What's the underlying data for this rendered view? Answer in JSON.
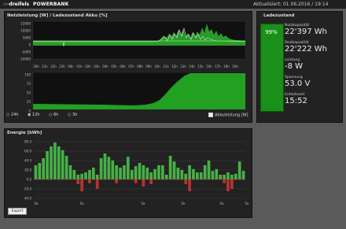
{
  "header": {
    "logo": "dreifels",
    "brand": "POWERBANK",
    "updated": "Aktualisiert: 01.06.2016 / 19:14"
  },
  "top_panel": {
    "title": "Netzleistung [W] / Ladezustand Akku [%]",
    "power_ticks": [
      "15000",
      "10000",
      "5000",
      "0",
      "-5000",
      "-10000"
    ],
    "time_ticks": [
      "20h",
      "21h",
      "22h",
      "23h",
      "00h",
      "01h",
      "02h",
      "03h",
      "04h",
      "05h",
      "06h",
      "07h",
      "08h",
      "09h",
      "10h",
      "11h",
      "12h",
      "13h",
      "14h",
      "15h",
      "16h",
      "17h",
      "18h",
      "19h"
    ],
    "soc_ticks": [
      "100",
      "75",
      "50",
      "25",
      "0"
    ],
    "range_options": [
      "24h",
      "12h",
      "6h",
      "3h"
    ],
    "akku_label": "Akkuleistung [W]"
  },
  "energy_panel": {
    "title": "Energie [kWh]",
    "ticks": [
      "80.0",
      "60.0",
      "40.0",
      "20.0",
      "0.0",
      "-20.0",
      "-40.0"
    ],
    "day_labels": [
      "Sa",
      "So",
      "Sa",
      "So",
      "Sa",
      "So"
    ],
    "export_label": "Export"
  },
  "ladezustand": {
    "title": "Ladezustand",
    "percent": "99%",
    "nutz_label": "Nutzkapazität",
    "nutz_value": "22'397 Wh",
    "rest_label": "Restkapazität",
    "rest_value": "22'222 Wh",
    "leistung_label": "Leistung",
    "leistung_value": "-8 W",
    "spannung_label": "Spannung",
    "spannung_value": "53.0 V",
    "entlade_label": "Entladezeit",
    "entlade_value": "15:52"
  },
  "chart_data": {
    "type": "bar",
    "title": "Energie [kWh]",
    "ylim": [
      -40,
      80
    ],
    "series": [
      {
        "values": [
          30,
          35,
          45,
          60,
          70,
          78,
          70,
          62,
          50,
          30,
          20,
          10,
          12,
          15,
          20,
          25,
          10,
          45,
          55,
          48,
          40,
          30,
          25,
          30,
          48,
          20,
          28,
          35,
          30,
          25,
          15,
          22,
          30,
          30,
          10,
          50,
          38,
          25,
          20,
          12,
          30,
          22,
          15,
          15,
          30,
          40,
          18,
          22,
          10,
          10,
          15,
          10,
          12,
          38,
          18
        ]
      },
      {
        "values": [
          0,
          0,
          0,
          0,
          0,
          0,
          0,
          0,
          0,
          0,
          0,
          -10,
          -25,
          0,
          -8,
          0,
          -20,
          0,
          0,
          0,
          0,
          -8,
          0,
          0,
          0,
          0,
          -8,
          0,
          -15,
          0,
          -10,
          0,
          0,
          0,
          0,
          0,
          0,
          0,
          0,
          -10,
          -25,
          0,
          0,
          0,
          0,
          0,
          0,
          0,
          0,
          -8,
          -25,
          -20,
          0,
          0,
          0
        ]
      }
    ]
  }
}
